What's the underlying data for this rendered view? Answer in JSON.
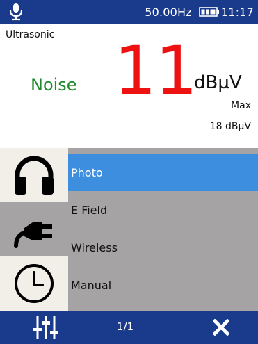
{
  "status_bar": {
    "frequency": "50.00Hz",
    "time": "11:17",
    "icons": [
      "microphone-icon",
      "battery-icon"
    ]
  },
  "measurement": {
    "mode": "Ultrasonic",
    "metric": "Noise",
    "value": "11",
    "unit": "dBµV",
    "max_label": "Max",
    "max_value": "18 dBµV",
    "colors": {
      "metric": "#1f8a2c",
      "value": "#ee1111"
    }
  },
  "menu": {
    "items": [
      {
        "label": "Photo",
        "selected": true
      },
      {
        "label": "E Field",
        "selected": false
      },
      {
        "label": "Wireless",
        "selected": false
      },
      {
        "label": "Manual",
        "selected": false
      }
    ],
    "side_icons": [
      "headphones-icon",
      "plug-icon",
      "clock-icon"
    ],
    "colors": {
      "selected": "#3e8ee0",
      "background": "#a5a3a3"
    }
  },
  "bottom_bar": {
    "page": "1/1",
    "icons": [
      "sliders-icon",
      "close-icon"
    ]
  },
  "theme": {
    "bar": "#1a3a8c"
  }
}
